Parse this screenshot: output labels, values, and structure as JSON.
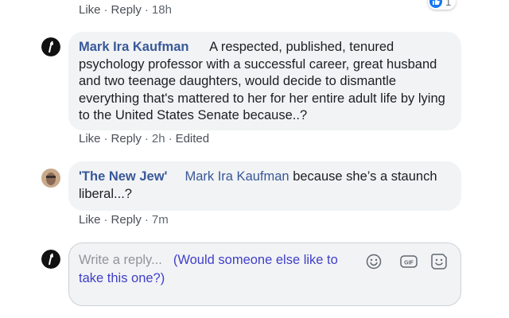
{
  "comments": [
    {
      "actions": {
        "like": "Like",
        "reply": "Reply",
        "time": "18h"
      },
      "reaction_count": "1"
    },
    {
      "author": "Mark Ira Kaufman",
      "text": "A respected, published, tenured psychology professor with a successful career, great husband and two teenage daughters, would decide to dismantle everything that's mattered to her for her entire adult life by lying to the United States Senate because..?",
      "actions": {
        "like": "Like",
        "reply": "Reply",
        "time": "2h",
        "edited": "Edited"
      }
    },
    {
      "author": "'The New Jew'",
      "mention": "Mark Ira Kaufman",
      "text": " because she’s a staunch liberal...?",
      "actions": {
        "like": "Like",
        "reply": "Reply",
        "time": "7m"
      }
    }
  ],
  "reply_box": {
    "placeholder": "Write a reply...",
    "typed_text": "(Would someone else like to take this one?)",
    "icons": [
      "emoji-icon",
      "gif-icon",
      "sticker-icon"
    ]
  },
  "colors": {
    "author": "#385898",
    "bubble_bg": "#f2f3f5",
    "meta": "#606770",
    "typed": "#4040c8",
    "like_blue": "#1877f2"
  }
}
